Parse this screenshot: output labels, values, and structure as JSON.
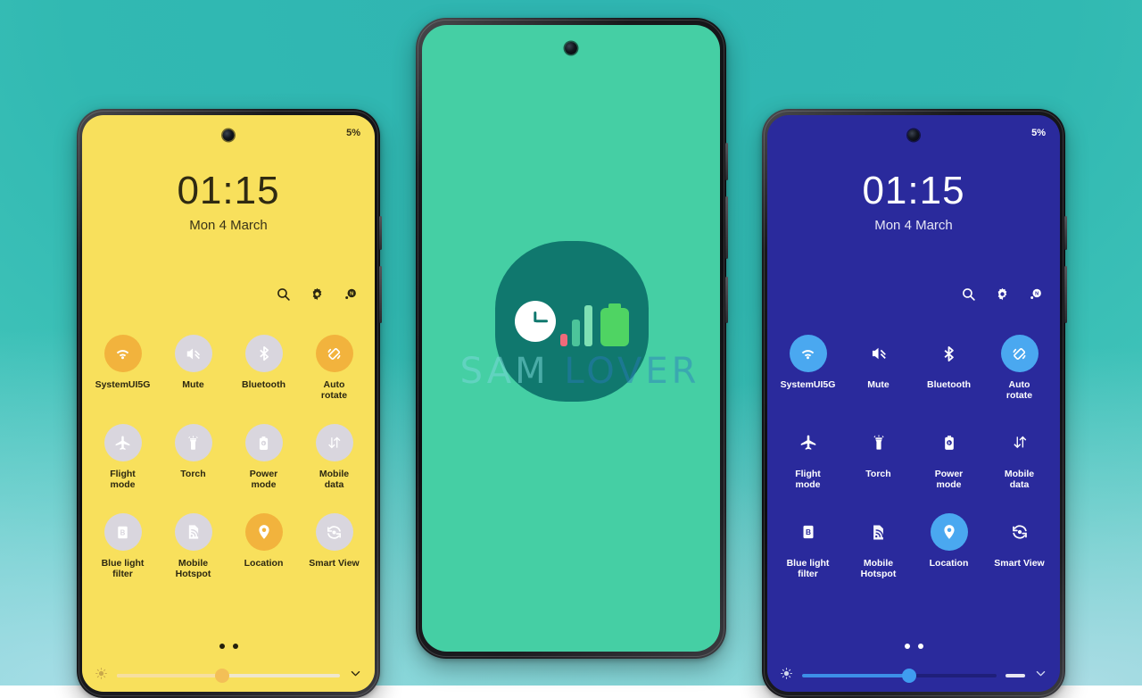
{
  "theme": {
    "background_top": "#31b9b2",
    "background_bottom_corners": "#a6dde6",
    "yellow_screen": "#f8e05c",
    "blue_screen": "#2a2a9c",
    "green_screen": "#45cfa4",
    "yellow_accent": "#f2b33d",
    "blue_accent": "#4aa8f0",
    "logo_teal": "#10786e"
  },
  "watermark": {
    "part_a": "SAM",
    "part_b": "LOVER",
    "full": "SAM LOVER"
  },
  "logo": {
    "name": "device-care-app-icon",
    "elements": [
      "clock",
      "signal-bars",
      "battery"
    ],
    "clock_color": "#ffffff",
    "bar_red": "#f06a7a",
    "bar_green_mid": "#4cc49a",
    "bar_green_tall": "#7fe0b4",
    "battery_color": "#4fd463"
  },
  "phones": [
    {
      "id": "phone-left",
      "theme": "yellow",
      "status": {
        "battery": "5%"
      },
      "clock": {
        "time": "01:15",
        "date": "Mon 4 March"
      },
      "header_icons": [
        {
          "name": "search-icon",
          "label": "Search"
        },
        {
          "name": "gear-icon",
          "label": "Settings"
        },
        {
          "name": "power-user-icon",
          "label": "Power"
        }
      ],
      "tiles": [
        {
          "label": "SystemUI5G",
          "icon": "wifi-icon",
          "state": "on"
        },
        {
          "label": "Mute",
          "icon": "mute-icon",
          "state": "off"
        },
        {
          "label": "Bluetooth",
          "icon": "bluetooth-icon",
          "state": "off"
        },
        {
          "label": "Auto\nrotate",
          "icon": "auto-rotate-icon",
          "state": "on"
        },
        {
          "label": "Flight\nmode",
          "icon": "airplane-icon",
          "state": "off"
        },
        {
          "label": "Torch",
          "icon": "torch-icon",
          "state": "off"
        },
        {
          "label": "Power\nmode",
          "icon": "power-mode-icon",
          "state": "off"
        },
        {
          "label": "Mobile\ndata",
          "icon": "mobile-data-icon",
          "state": "off"
        },
        {
          "label": "Blue light\nfilter",
          "icon": "blue-light-filter-icon",
          "state": "off"
        },
        {
          "label": "Mobile\nHotspot",
          "icon": "hotspot-icon",
          "state": "off"
        },
        {
          "label": "Location",
          "icon": "location-icon",
          "state": "on"
        },
        {
          "label": "Smart View",
          "icon": "smart-view-icon",
          "state": "off"
        }
      ],
      "pager": {
        "pages": 2,
        "active": 1
      },
      "brightness": {
        "value": 47,
        "icon": "brightness-icon",
        "expand_icon": "chevron-down-icon",
        "show_dash": false
      }
    },
    {
      "id": "phone-center",
      "theme": "green",
      "status": {
        "battery": ""
      },
      "clock": {
        "time": "",
        "date": ""
      },
      "header_icons": [],
      "tiles": [],
      "pager": {
        "pages": 0,
        "active": 0
      },
      "brightness": null
    },
    {
      "id": "phone-right",
      "theme": "blue",
      "status": {
        "battery": "5%"
      },
      "clock": {
        "time": "01:15",
        "date": "Mon 4 March"
      },
      "header_icons": [
        {
          "name": "search-icon",
          "label": "Search"
        },
        {
          "name": "gear-icon",
          "label": "Settings"
        },
        {
          "name": "power-user-icon",
          "label": "Power"
        }
      ],
      "tiles": [
        {
          "label": "SystemUI5G",
          "icon": "wifi-icon",
          "state": "on"
        },
        {
          "label": "Mute",
          "icon": "mute-icon",
          "state": "off"
        },
        {
          "label": "Bluetooth",
          "icon": "bluetooth-icon",
          "state": "off"
        },
        {
          "label": "Auto\nrotate",
          "icon": "auto-rotate-icon",
          "state": "on"
        },
        {
          "label": "Flight\nmode",
          "icon": "airplane-icon",
          "state": "off"
        },
        {
          "label": "Torch",
          "icon": "torch-icon",
          "state": "off"
        },
        {
          "label": "Power\nmode",
          "icon": "power-mode-icon",
          "state": "off"
        },
        {
          "label": "Mobile\ndata",
          "icon": "mobile-data-icon",
          "state": "off"
        },
        {
          "label": "Blue light\nfilter",
          "icon": "blue-light-filter-icon",
          "state": "off"
        },
        {
          "label": "Mobile\nHotspot",
          "icon": "hotspot-icon",
          "state": "off"
        },
        {
          "label": "Location",
          "icon": "location-icon",
          "state": "on"
        },
        {
          "label": "Smart View",
          "icon": "smart-view-icon",
          "state": "off"
        }
      ],
      "pager": {
        "pages": 2,
        "active": 1
      },
      "brightness": {
        "value": 55,
        "icon": "brightness-icon",
        "expand_icon": "chevron-down-icon",
        "show_dash": true
      }
    }
  ]
}
